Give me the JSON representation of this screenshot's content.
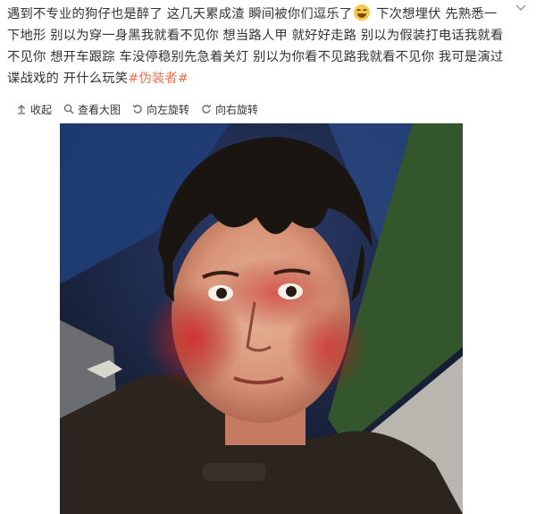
{
  "post": {
    "text_part1": "遇到不专业的狗仔也是醉了 这几天累成渣 瞬间被你们逗乐了",
    "emoji_icon": "laughing-face-emoji",
    "text_part2": " 下次想埋伏 先熟悉一下地形 别以为穿一身黑我就看不见你 想当路人甲 就好好走路 别以为假装打电话我就看不见你 想开车跟踪 车没停稳别先急着关灯 别以为你看不见路我就看不见你 我可是演过谍战戏的 开什么玩笑",
    "hashtag": "#伪装者#"
  },
  "toolbar": {
    "collapse_label": "收起",
    "view_large_label": "查看大图",
    "rotate_left_label": "向左旋转",
    "rotate_right_label": "向右旋转"
  },
  "colors": {
    "hashtag": "#eb7350",
    "text": "#333333"
  }
}
